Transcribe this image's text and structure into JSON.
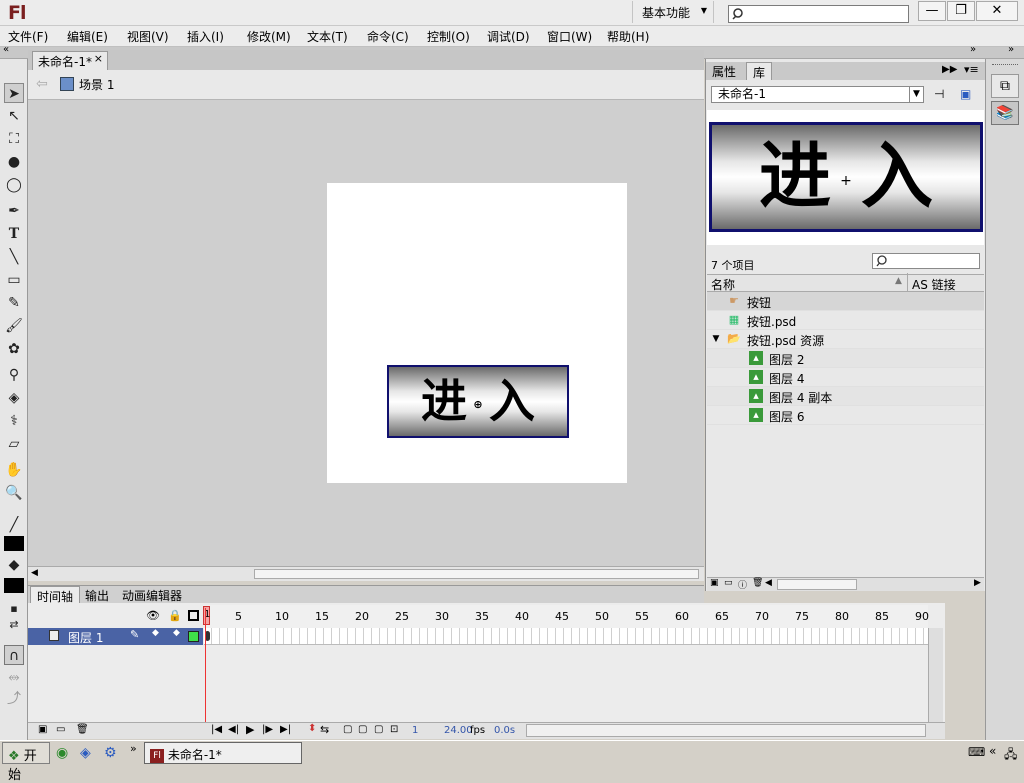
{
  "titlebar": {
    "logo": "Fl",
    "workspace": "基本功能",
    "window_buttons": [
      "—",
      "❐",
      "✕"
    ]
  },
  "menubar": {
    "items": [
      "文件(F)",
      "编辑(E)",
      "视图(V)",
      "插入(I)",
      "修改(M)",
      "文本(T)",
      "命令(C)",
      "控制(O)",
      "调试(D)",
      "窗口(W)",
      "帮助(H)"
    ]
  },
  "document": {
    "tab_label": "未命名-1*",
    "tab_close": "×",
    "scene_label": "场景 1"
  },
  "stage": {
    "button_text": "进入",
    "button_char1": "进",
    "button_char2": "入"
  },
  "timeline": {
    "tabs": [
      "时间轴",
      "输出",
      "动画编辑器"
    ],
    "frame_numbers": [
      "1",
      "5",
      "10",
      "15",
      "20",
      "25",
      "30",
      "35",
      "40",
      "45",
      "50",
      "55",
      "60",
      "65",
      "70",
      "75",
      "80",
      "85",
      "90"
    ],
    "layer_name": "图层 1",
    "current_frame": "1",
    "fps": "24.00",
    "fps_unit": "fps",
    "time": "0.0s"
  },
  "library": {
    "tabs": [
      "属性",
      "库"
    ],
    "document_select": "未命名-1",
    "item_count": "7 个项目",
    "col_name": "名称",
    "col_linkage": "AS 链接",
    "items": [
      {
        "label": "按钮",
        "icon": "button-symbol-icon",
        "indent": 0
      },
      {
        "label": "按钮.psd",
        "icon": "bitmap-icon",
        "indent": 0
      },
      {
        "label": "按钮.psd 资源",
        "icon": "folder-open-icon",
        "indent": 0
      },
      {
        "label": "图层 2",
        "icon": "bitmap-image-icon",
        "indent": 1
      },
      {
        "label": "图层 4",
        "icon": "bitmap-image-icon",
        "indent": 1
      },
      {
        "label": "图层 4 副本",
        "icon": "bitmap-image-icon",
        "indent": 1
      },
      {
        "label": "图层 6",
        "icon": "bitmap-image-icon",
        "indent": 1
      }
    ]
  },
  "taskbar": {
    "start": "开始",
    "task_label": "未命名-1*"
  },
  "colors": {
    "layer_selected": "#4a63a5",
    "playhead": "#e33333",
    "symbol_border": "#10106e"
  }
}
